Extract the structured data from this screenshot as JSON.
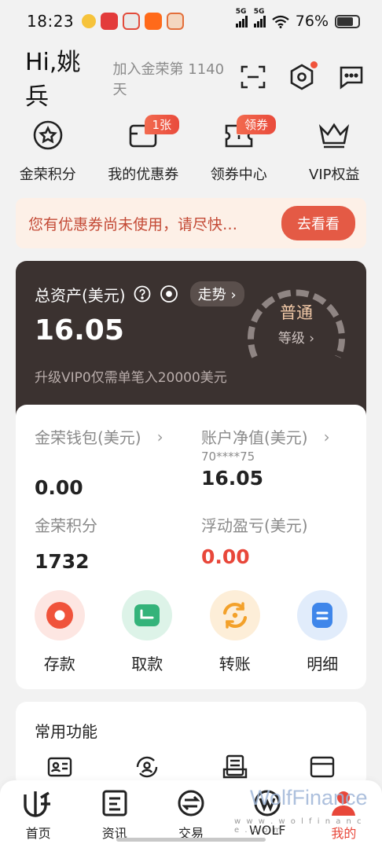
{
  "status": {
    "time": "18:23",
    "battery": "76%",
    "battery_level": 0.76,
    "net1": "5G",
    "net2": "5G"
  },
  "header": {
    "greeting": "Hi,姚兵",
    "join_text": "加入金荣第 1140 天"
  },
  "quick": [
    {
      "label": "金荣积分",
      "badge": ""
    },
    {
      "label": "我的优惠券",
      "badge": "1张"
    },
    {
      "label": "领券中心",
      "badge": "领券"
    },
    {
      "label": "VIP权益",
      "badge": ""
    }
  ],
  "notice": {
    "text": "您有优惠券尚未使用，请尽快…",
    "button": "去看看"
  },
  "asset": {
    "label": "总资产(美元)",
    "trend": "走势",
    "value": "16.05",
    "level": "普通",
    "level_sub": "等级",
    "vip_note": "升级VIP0仅需单笔入20000美元"
  },
  "wallet": {
    "wallet_label": "金荣钱包(美元)",
    "wallet_value": "0.00",
    "equity_label": "账户净值(美元)",
    "account": "70****75",
    "equity_value": "16.05",
    "points_label": "金荣积分",
    "points_value": "1732",
    "pnl_label": "浮动盈亏(美元)",
    "pnl_value": "0.00"
  },
  "actions": [
    {
      "label": "存款"
    },
    {
      "label": "取款"
    },
    {
      "label": "转账"
    },
    {
      "label": "明细"
    }
  ],
  "common": {
    "title": "常用功能"
  },
  "tabs": [
    {
      "label": "首页"
    },
    {
      "label": "资讯"
    },
    {
      "label": "交易"
    },
    {
      "label": "WOLF"
    },
    {
      "label": "我的"
    }
  ],
  "watermark": {
    "brand": "WolfFinance",
    "url": "w w w . w o l f i n a n c e . c o m"
  },
  "colors": {
    "accent": "#e8473a",
    "asset_bg": "#3b3230",
    "notice_bg": "#fdf0e7"
  }
}
